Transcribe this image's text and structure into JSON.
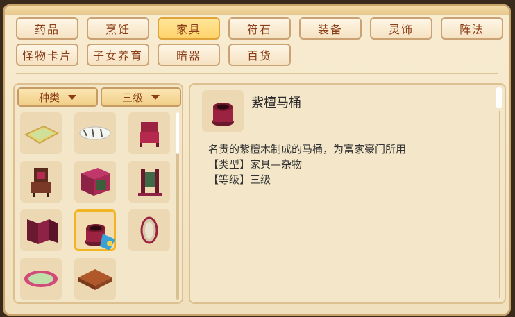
{
  "tabs": [
    {
      "label": "药品"
    },
    {
      "label": "烹饪"
    },
    {
      "label": "家具"
    },
    {
      "label": "符石"
    },
    {
      "label": "装备"
    },
    {
      "label": "灵饰"
    },
    {
      "label": "阵法"
    },
    {
      "label": "怪物卡片"
    },
    {
      "label": "子女养育"
    },
    {
      "label": "暗器"
    },
    {
      "label": "百货"
    }
  ],
  "active_tab": "家具",
  "filters": {
    "type_label": "种类",
    "level_label": "三级"
  },
  "items": [
    {
      "name": "rug-item"
    },
    {
      "name": "tiger-skin-item"
    },
    {
      "name": "red-chair-item"
    },
    {
      "name": "carved-throne-item"
    },
    {
      "name": "red-cabinet-item"
    },
    {
      "name": "screen-stand-item"
    },
    {
      "name": "folding-screen-item"
    },
    {
      "name": "toilet-item",
      "selected": true
    },
    {
      "name": "round-mirror-item"
    },
    {
      "name": "oval-mat-item"
    },
    {
      "name": "wooden-floor-item"
    }
  ],
  "detail": {
    "title": "紫檀马桶",
    "description": "名贵的紫檀木制成的马桶，为富家豪门所用",
    "type_line": "【类型】家具—杂物",
    "level_line": "【等级】三级"
  },
  "colors": {
    "accent": "#f1b524",
    "text_brown": "#8a3d17",
    "panel": "#f4e6c8"
  }
}
